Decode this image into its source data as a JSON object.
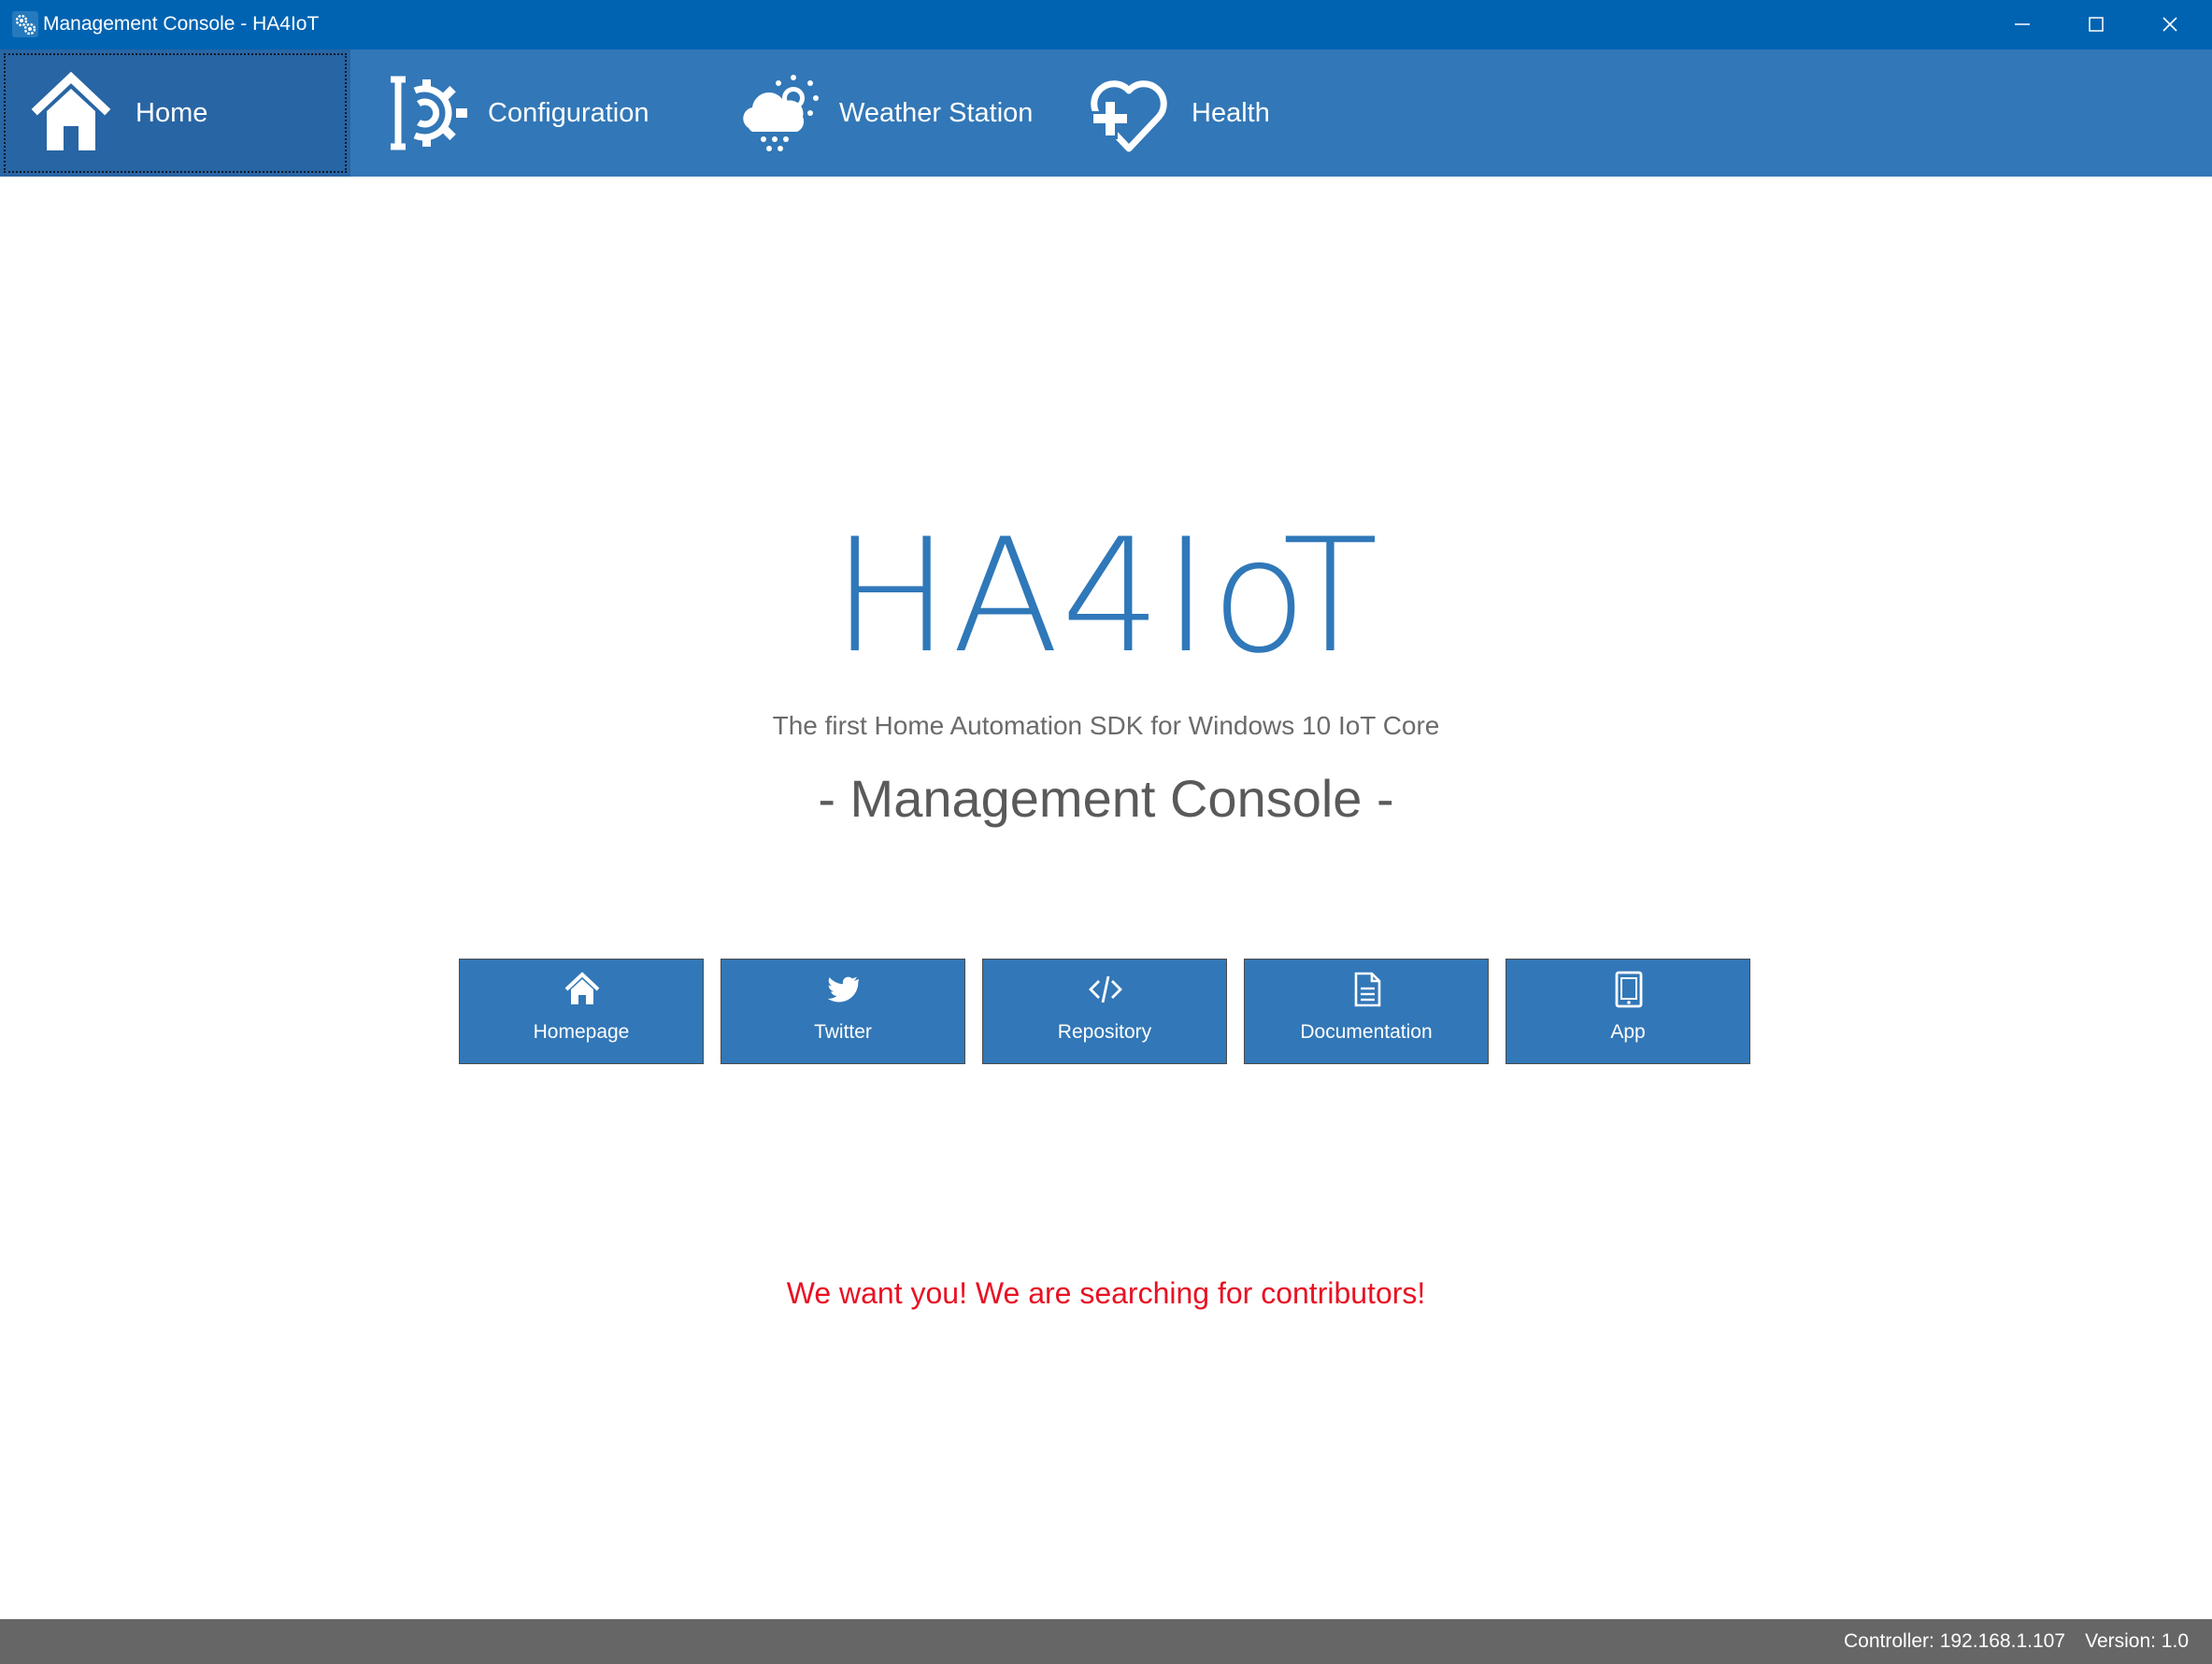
{
  "window": {
    "title": "Management Console - HA4IoT",
    "titlebar_color": "#0063b1",
    "controls": [
      "minimize-icon",
      "maximize-icon",
      "close-icon"
    ]
  },
  "nav": {
    "color": "#3277b7",
    "active_color": "#2865a4",
    "items": [
      {
        "label": "Home",
        "icon": "house-icon",
        "active": true
      },
      {
        "label": "Configuration",
        "icon": "gear-wrench-icon",
        "active": false
      },
      {
        "label": "Weather Station",
        "icon": "weather-cloud-sun-icon",
        "active": false
      },
      {
        "label": "Health",
        "icon": "heart-plus-icon",
        "active": false
      }
    ]
  },
  "hero": {
    "title": "HA4IoT",
    "title_color": "#2f78b9",
    "tagline": "The first Home Automation SDK for Windows 10 IoT Core",
    "subtitle": "- Management Console -"
  },
  "links": [
    {
      "label": "Homepage",
      "icon": "home-icon"
    },
    {
      "label": "Twitter",
      "icon": "twitter-bird-icon"
    },
    {
      "label": "Repository",
      "icon": "code-icon"
    },
    {
      "label": "Documentation",
      "icon": "document-icon"
    },
    {
      "label": "App",
      "icon": "tablet-icon"
    }
  ],
  "contributors_message": "We want you! We are searching for contributors!",
  "contributors_color": "#e81123",
  "status": {
    "controller": "Controller: 192.168.1.107",
    "version": "Version: 1.0",
    "color": "#666666"
  }
}
